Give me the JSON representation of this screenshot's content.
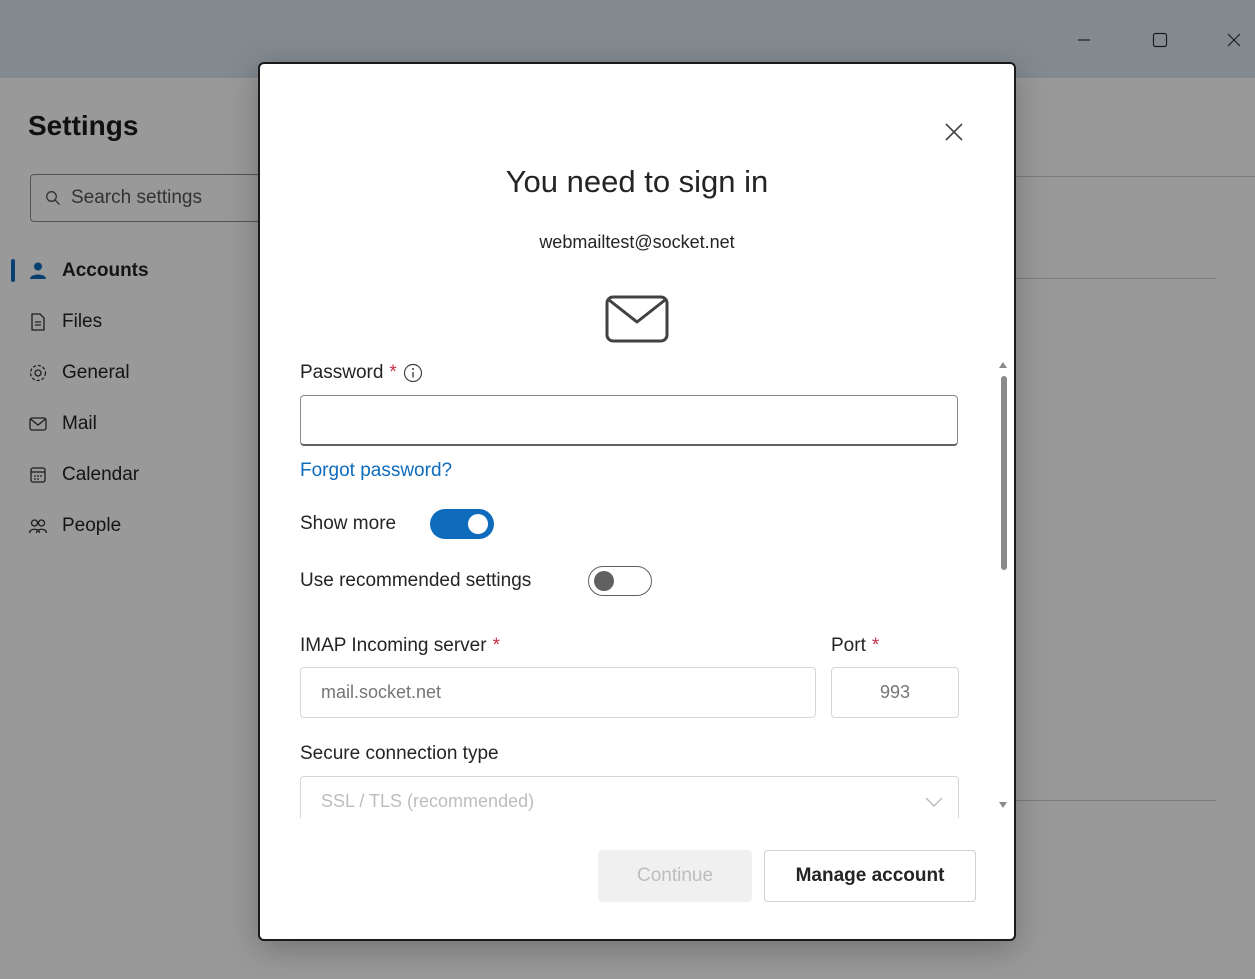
{
  "settings": {
    "title": "Settings",
    "search_placeholder": "Search settings",
    "nav": [
      {
        "label": "Accounts",
        "icon": "person-icon",
        "active": true
      },
      {
        "label": "Files",
        "icon": "file-icon"
      },
      {
        "label": "General",
        "icon": "gear-icon"
      },
      {
        "label": "Mail",
        "icon": "mail-icon"
      },
      {
        "label": "Calendar",
        "icon": "calendar-icon"
      },
      {
        "label": "People",
        "icon": "people-icon"
      }
    ]
  },
  "dialog": {
    "title": "You need to sign in",
    "email": "webmailtest@socket.net",
    "password_label": "Password",
    "required_mark": "*",
    "forgot_password": "Forgot password?",
    "show_more_label": "Show more",
    "show_more_on": true,
    "recommended_label": "Use recommended settings",
    "recommended_on": false,
    "imap_label": "IMAP Incoming server",
    "imap_placeholder": "mail.socket.net",
    "port_label": "Port",
    "port_placeholder": "993",
    "secure_label": "Secure connection type",
    "secure_value": "SSL / TLS (recommended)",
    "continue_label": "Continue",
    "manage_label": "Manage account"
  },
  "colors": {
    "accent": "#0f6cbd",
    "required": "#c4314b"
  }
}
